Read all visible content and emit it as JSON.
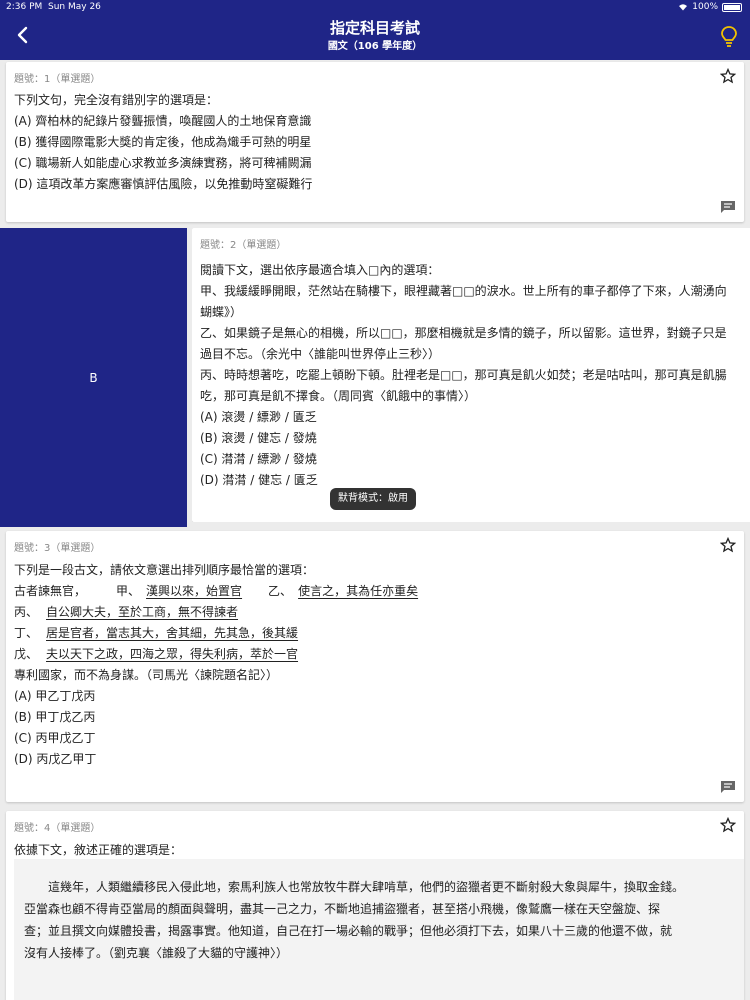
{
  "status": {
    "time": "2:36 PM",
    "date": "Sun May 26",
    "battery": "100%"
  },
  "header": {
    "title": "指定科目考試",
    "subtitle": "國文（106 學年度）"
  },
  "answer_panel": {
    "label": "B"
  },
  "toast": {
    "text": "默背模式：啟用"
  },
  "q1": {
    "number": "題號：1（單選題）",
    "prompt": "下列文句，完全沒有錯別字的選項是：",
    "options": [
      "(A) 齊柏林的紀錄片發聾振憒，喚醒國人的土地保育意識",
      "(B) 獲得國際電影大獎的肯定後，他成為熾手可熱的明星",
      "(C) 職場新人如能虛心求教並多演練實務，將可稗補闕漏",
      "(D) 這項改革方案應審慎評估風險，以免推動時窒礙難行"
    ]
  },
  "q2": {
    "number": "題號：2（單選題）",
    "lines": [
      "閱讀下文，選出依序最適合填入□內的選項：",
      "甲、我緩緩睜開眼，茫然站在騎樓下，眼裡藏著□□的淚水。世上所有的車子都停了下來，人潮湧向",
      "蝴蝶》）",
      "乙、如果鏡子是無心的相機，所以□□，那麼相機就是多情的鏡子，所以留影。這世界，對鏡子只是",
      "過目不忘。（余光中〈誰能叫世界停止三秒〉）",
      "丙、時時想著吃，吃罷上頓盼下頓。肚裡老是□□，那可真是飢火如焚；老是咕咕叫，那可真是飢腸",
      "吃，那可真是飢不擇食。（周同賓〈飢餓中的事情〉）"
    ],
    "options": [
      "(A) 滾燙 / 縹渺 / 匱乏",
      "(B) 滾燙 / 健忘 / 發燒",
      "(C) 潸潸 / 縹渺 / 發燒",
      "(D) 潸潸 / 健忘 / 匱乏"
    ]
  },
  "q3": {
    "number": "題號：3（單選題）",
    "prompt": "下列是一段古文，請依文意選出排列順序最恰當的選項：",
    "l1_start": "古者諫無官，",
    "l1_jia": "甲、",
    "l1_jia_text": "漢興以來，始置官",
    "l1_yi": "乙、",
    "l1_yi_text": "使言之，其為任亦重矣",
    "l2_label": "丙、",
    "l2_text": "自公卿大夫，至於工商，無不得諫者",
    "l3_label": "丁、",
    "l3_text": "居是官者，當志其大，舍其細，先其急，後其緩",
    "l4_label": "戊、",
    "l4_text": "夫以天下之政，四海之眾，得失利病，萃於一官",
    "l5": "專利國家，而不為身謀。（司馬光〈諫院題名記〉）",
    "options": [
      "(A) 甲乙丁戊丙",
      "(B) 甲丁戊乙丙",
      "(C) 丙甲戊乙丁",
      "(D) 丙戊乙甲丁"
    ]
  },
  "q4": {
    "number": "題號：4（單選題）",
    "prompt": "依據下文，敘述正確的選項是：",
    "passage": [
      "　　這幾年，人類繼續移民入侵此地，索馬利族人也常放牧牛群大肆啃草，他們的盜獵者更不斷射殺大象與犀牛，換取金錢。",
      "亞當森也顧不得肯亞當局的顏面與聲明，盡其一己之力，不斷地追捕盜獵者，甚至搭小飛機，像鷲鷹一樣在天空盤旋、探",
      "查；並且撰文向媒體投書，揭露事實。他知道，自己在打一場必輸的戰爭；但他必須打下去，如果八十三歲的他還不做，就",
      "沒有人接棒了。（劉克襄〈誰殺了大貓的守護神〉）"
    ]
  }
}
